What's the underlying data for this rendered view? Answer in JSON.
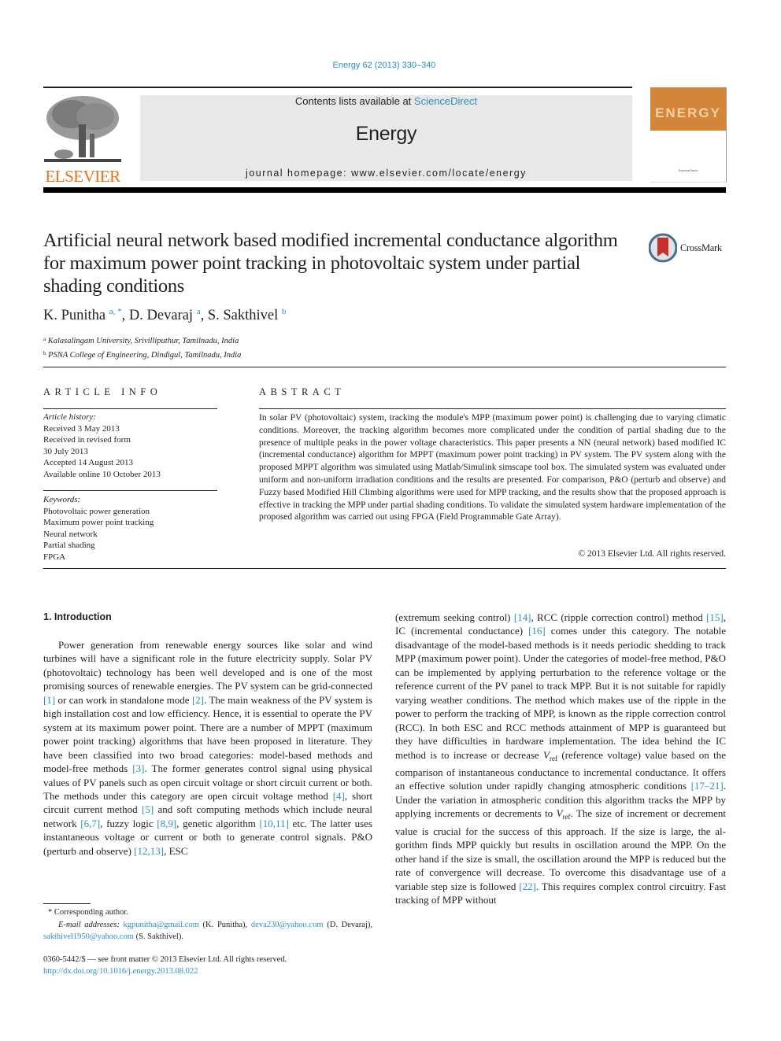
{
  "header": {
    "citation": "Energy 62 (2013) 330–340",
    "publisher_logo_text": "ELSEVIER",
    "contents_prefix": "Contents lists available at ",
    "contents_link": "ScienceDirect",
    "journal_name": "Energy",
    "homepage_line": "journal homepage: www.elsevier.com/locate/energy",
    "cover_title": "ENERGY",
    "cover_footer": "ScienceDirect",
    "colors": {
      "link": "#2a8fbd",
      "elsevier_orange": "#e9711c",
      "cover_orange": "#d3853a",
      "masthead_gray": "#e8e8e8"
    }
  },
  "article": {
    "title": "Artificial neural network based modified incremental conductance algorithm for maximum power point tracking in photovoltaic system under partial shading conditions",
    "crossmark_label": "CrossMark",
    "authors": [
      {
        "name": "K. Punitha",
        "sup": "a, *"
      },
      {
        "name": "D. Devaraj",
        "sup": "a"
      },
      {
        "name": "S. Sakthivel",
        "sup": "b"
      }
    ],
    "affiliations": [
      {
        "mark": "a",
        "text": "Kalasalingam University, Srivilliputhur, Tamilnadu, India"
      },
      {
        "mark": "b",
        "text": "PSNA College of Engineering, Dindigul, Tamilnadu, India"
      }
    ]
  },
  "article_info": {
    "heading": "ARTICLE INFO",
    "history_label": "Article history:",
    "history": [
      "Received 3 May 2013",
      "Received in revised form",
      "30 July 2013",
      "Accepted 14 August 2013",
      "Available online 10 October 2013"
    ],
    "keywords_label": "Keywords:",
    "keywords": [
      "Photovoltaic power generation",
      "Maximum power point tracking",
      "Neural network",
      "Partial shading",
      "FPGA"
    ]
  },
  "abstract": {
    "heading": "ABSTRACT",
    "text": "In solar PV (photovoltaic) system, tracking the module's MPP (maximum power point) is challenging due to varying climatic conditions. Moreover, the tracking algorithm becomes more complicated under the condition of partial shading due to the presence of multiple peaks in the power voltage characteristics. This paper presents a NN (neural network) based modified IC (incremental conductance) algorithm for MPPT (maximum power point tracking) in PV system. The PV system along with the proposed MPPT algorithm was simulated using Matlab/Simulink simscape tool box. The simulated system was evaluated under uniform and non-uniform irradiation conditions and the results are presented. For comparison, P&O (perturb and observe) and Fuzzy based Modified Hill Climbing algorithms were used for MPP tracking, and the results show that the proposed approach is effective in tracking the MPP under partial shading conditions. To validate the simulated system hardware implementation of the proposed algo­rithm was carried out using FPGA (Field Programmable Gate Array).",
    "copyright": "© 2013 Elsevier Ltd. All rights reserved."
  },
  "introduction": {
    "heading": "1.  Introduction",
    "left": [
      {
        "t": "Power generation from renewable energy sources like solar and wind turbines will have a significant role in the future electricity supply. Solar PV (photovoltaic) technology has been well developed and is one of the most promising sources of renewable energies. The PV system can be grid-connected "
      },
      {
        "ref": "[1]"
      },
      {
        "t": " or can work in standalone mode "
      },
      {
        "ref": "[2]"
      },
      {
        "t": ". The main weakness of the PV system is high installation cost and low efficiency. Hence, it is essential to operate the PV sys­tem at its maximum power point. There are a number of MPPT (maximum power point tracking) algorithms that have been pro­posed in literature. They have been classified into two broad cate­gories: model-based methods and model-free methods "
      },
      {
        "ref": "[3]"
      },
      {
        "t": ". The former generates control signal using physical values of PV panels such as open circuit voltage or short circuit current or both. The methods under this category are open circuit voltage method "
      },
      {
        "ref": "[4]"
      },
      {
        "t": ", short circuit current method "
      },
      {
        "ref": "[5]"
      },
      {
        "t": " and soft computing methods which include neural network "
      },
      {
        "ref": "[6,7]"
      },
      {
        "t": ", fuzzy logic "
      },
      {
        "ref": "[8,9]"
      },
      {
        "t": ", genetic algorithm "
      },
      {
        "ref": "[10,11]"
      },
      {
        "t": " etc. The latter uses instantaneous voltage or current or both to generate control signals. P&O (perturb and observe) "
      },
      {
        "ref": "[12,13]"
      },
      {
        "t": ", ESC"
      }
    ],
    "right": [
      {
        "t": "(extremum seeking control) "
      },
      {
        "ref": "[14]"
      },
      {
        "t": ", RCC (ripple correction control) method "
      },
      {
        "ref": "[15]"
      },
      {
        "t": ", IC (incremental conductance) "
      },
      {
        "ref": "[16]"
      },
      {
        "t": " comes under this category. The notable disadvantage of the model-based methods is it needs periodic shedding to track MPP (maximum power point). Under the categories of model-free method, P&O can be imple­mented by applying perturbation to the reference voltage or the reference current of the PV panel to track MPP. But it is not suitable for rapidly varying weather conditions. The method which makes use of the ripple in the power to perform the tracking of MPP, is known as the ripple correction control (RCC). In both ESC and RCC methods attainment of MPP is guaranteed but they have difficulties in hardware implementation. The idea behind the IC method is to increase or decrease "
      },
      {
        "v": "V",
        "sub": "ref"
      },
      {
        "t": " (reference voltage) value based on the comparison of instantaneous conductance to incremental conduc­tance. It offers an effective solution under rapidly changing atmo­spheric conditions "
      },
      {
        "ref": "[17–21]"
      },
      {
        "t": ". Under the variation in atmospheric condition this algorithm tracks the MPP by applying increments or decrements to "
      },
      {
        "v": "V",
        "sub": "ref"
      },
      {
        "t": ". The size of increment or decrement value is crucial for the success of this approach. If the size is large, the al­gorithm finds MPP quickly but results in oscillation around the MPP. On the other hand if the size is small, the oscillation around the MPP is reduced but the rate of convergence will decrease. To overcome this disadvantage use of a variable step size is followed "
      },
      {
        "ref": "[22]"
      },
      {
        "t": ". This requires complex control circuitry. Fast tracking of MPP without"
      }
    ]
  },
  "footnotes": {
    "corresponding": "* Corresponding author.",
    "email_label": "E-mail addresses:",
    "emails": [
      {
        "address": "kgpunitha@gmail.com",
        "name": "(K. Punitha),"
      },
      {
        "address": "deva230@yahoo.com",
        "name": "(D. Devaraj),"
      },
      {
        "address": "sakthivel1950@yahoo.com",
        "name": "(S. Sakthivel)."
      }
    ],
    "front_matter": "0360-5442/$ — see front matter © 2013 Elsevier Ltd. All rights reserved.",
    "doi": "http://dx.doi.org/10.1016/j.energy.2013.08.022"
  }
}
